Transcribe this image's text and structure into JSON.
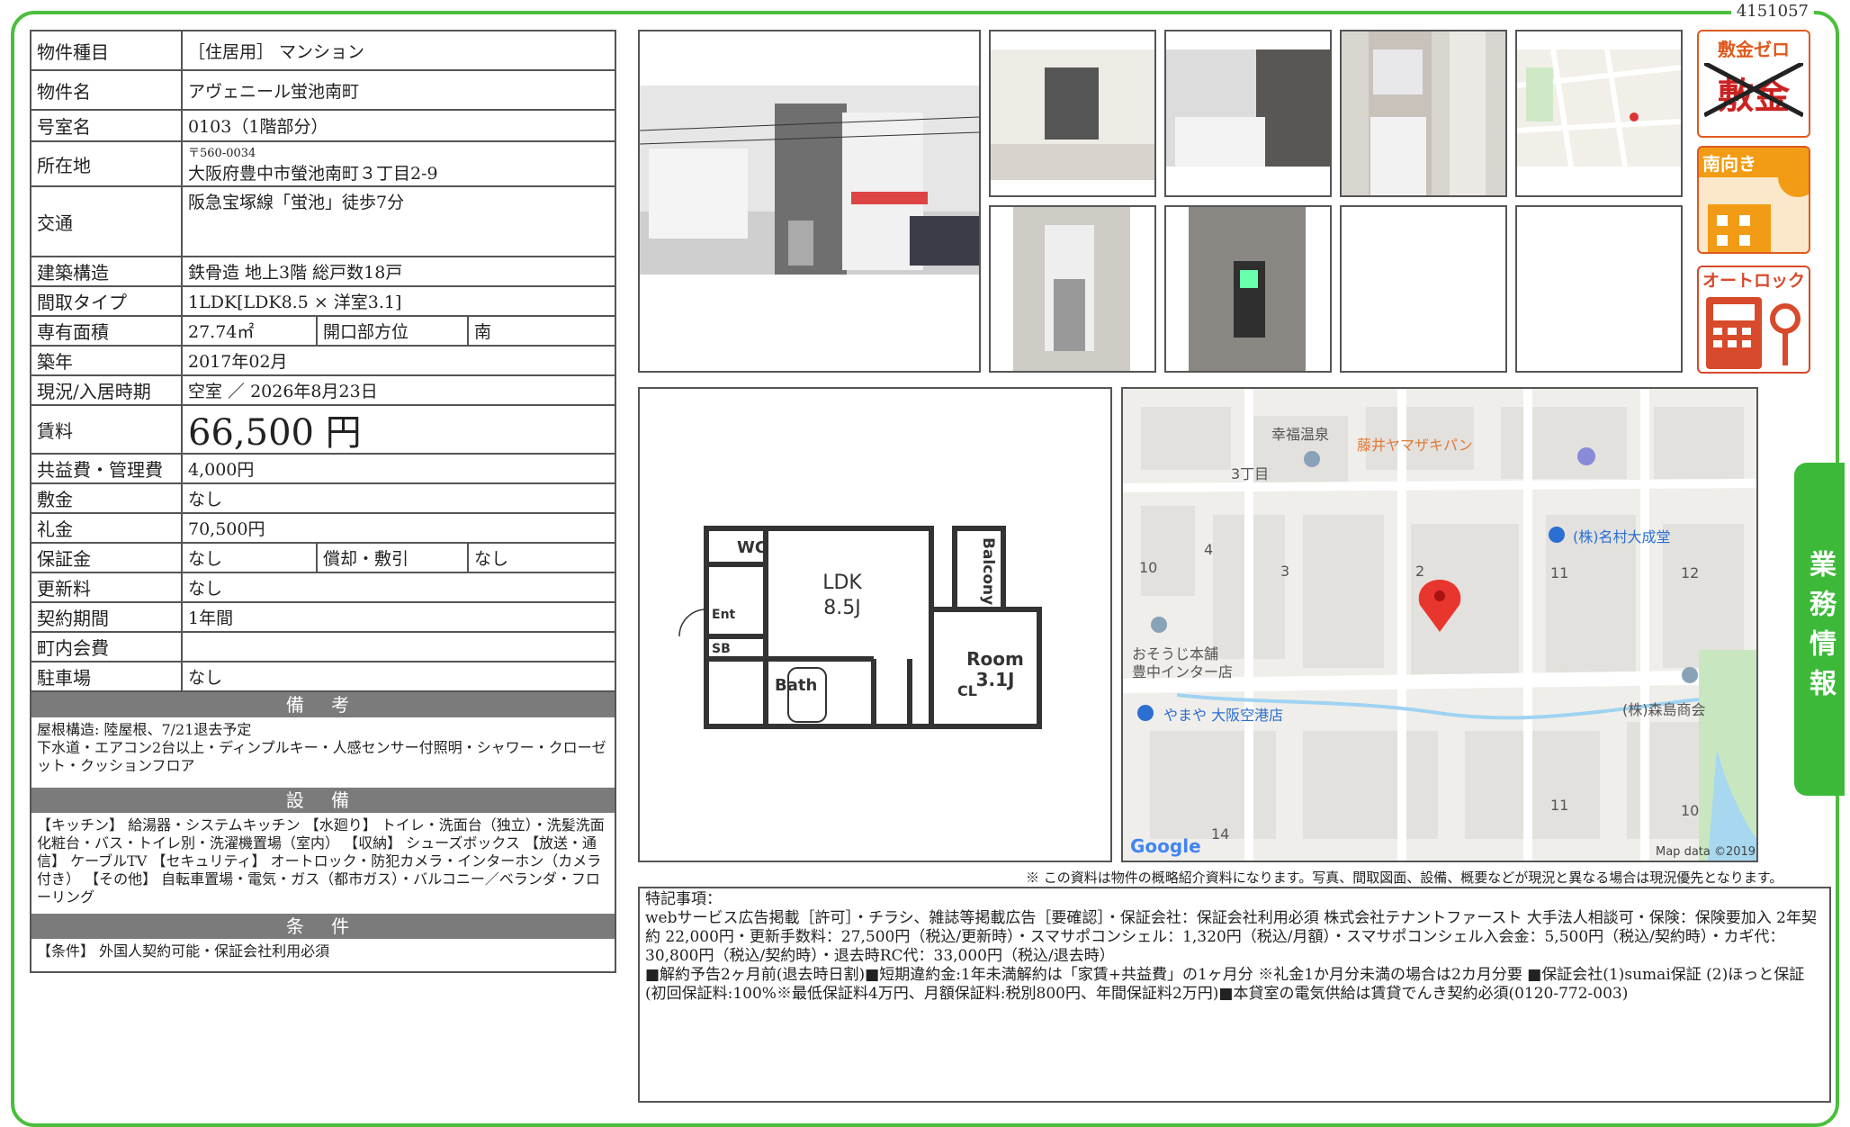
{
  "doc_id": "4151057",
  "property": {
    "type_label": "物件種目",
    "type_value": "［住居用］ マンション",
    "name_label": "物件名",
    "name_value": "アヴェニール蛍池南町",
    "room_label": "号室名",
    "room_value": "0103（1階部分）",
    "address_label": "所在地",
    "postal": "〒560-0034",
    "address_value": "大阪府豊中市螢池南町３丁目2-9",
    "transport_label": "交通",
    "transport_value": "阪急宝塚線「蛍池」徒歩7分",
    "structure_label": "建築構造",
    "structure_value": "鉄骨造 地上3階 総戸数18戸",
    "layout_label": "間取タイプ",
    "layout_value": "1LDK[LDK8.5 × 洋室3.1]",
    "area_label": "専有面積",
    "area_value": "27.74㎡",
    "facing_label": "開口部方位",
    "facing_value": "南",
    "built_label": "築年",
    "built_value": "2017年02月",
    "status_label": "現況/入居時期",
    "status_value": "空室 ／ 2026年8月23日",
    "rent_label": "賃料",
    "rent_value": "66,500 円",
    "fee_label": "共益費・管理費",
    "fee_value": "4,000円",
    "deposit_label": "敷金",
    "deposit_value": "なし",
    "key_label": "礼金",
    "key_value": "70,500円",
    "guarantee_label": "保証金",
    "guarantee_value": "なし",
    "amort_label": "償却・敷引",
    "amort_value": "なし",
    "renew_label": "更新料",
    "renew_value": "なし",
    "contract_label": "契約期間",
    "contract_value": "1年間",
    "town_label": "町内会費",
    "town_value": "",
    "parking_label": "駐車場",
    "parking_value": "なし"
  },
  "sections": {
    "remarks_head": "備 考",
    "remarks_text": "屋根構造: 陸屋根、7/21退去予定\n下水道・エアコン2台以上・ディンプルキー・人感センサー付照明・シャワー・クローゼット・クッションフロア",
    "equip_head": "設 備",
    "equip_text": "【キッチン】 給湯器・システムキッチン 【水廻り】 トイレ・洗面台（独立）・洗髪洗面化粧台・バス・トイレ別・洗濯機置場（室内） 【収納】 シューズボックス 【放送・通信】 ケーブルTV 【セキュリティ】 オートロック・防犯カメラ・インターホン（カメラ付き） 【その他】 自転車置場・電気・ガス（都市ガス）・バルコニー／ベランダ・フローリング",
    "cond_head": "条 件",
    "cond_text": "【条件】 外国人契約可能・保証会社利用必須"
  },
  "badges": {
    "zero_deposit": "敷金ゼロ",
    "zero_deposit_cross": "敷金",
    "south": "南向き",
    "autolock": "オートロック"
  },
  "floorplan": {
    "wc": "WC",
    "ent": "Ent",
    "sb": "SB",
    "bath": "Bath",
    "ldk": "LDK",
    "ldk_size": "8.5J",
    "balcony": "Balcony",
    "room": "Room",
    "room_size": "3.1J",
    "cl": "CL"
  },
  "map": {
    "labels": [
      "幸福温泉",
      "藤井ヤマザキパン",
      "3丁目",
      "(株)名村大成堂",
      "10",
      "4",
      "3",
      "2",
      "11",
      "12",
      "おそうじ本舗",
      "豊中インター店",
      "やまや 大阪空港店",
      "(株)森島商会",
      "11",
      "10",
      "14"
    ],
    "google": "Google",
    "mapdata": "Map data ©2019"
  },
  "side_tab": "業務情報",
  "footnote": "※ この資料は物件の概略紹介資料になります。写真、間取図面、設備、概要などが現況と異なる場合は現況優先となります。",
  "special": {
    "title": "特記事項：",
    "text": "webサービス広告掲載［許可］・チラシ、雑誌等掲載広告［要確認］・保証会社：保証会社利用必須 株式会社テナントファースト 大手法人相談可・保険：保険要加入 2年契約 22,000円・更新手数料：27,500円（税込/更新時）・スマサポコンシェル：1,320円（税込/月額）・スマサポコンシェル入会金：5,500円（税込/契約時）・カギ代：30,800円（税込/契約時）・退去時RC代：33,000円（税込/退去時）\n■解約予告2ヶ月前(退去時日割)■短期違約金:1年未満解約は「家賃+共益費」の1ヶ月分 ※礼金1か月分未満の場合は2カ月分要 ■保証会社(1)sumai保証 (2)ほっと保証(初回保証料:100%※最低保証料4万円、月額保証料:税別800円、年間保証料2万円)■本貸室の電気供給は賃貸でんき契約必須(0120-772-003)"
  },
  "colors": {
    "accent_green": "#3db93a",
    "badge_orange": "#e05a1e",
    "header_gray": "#7b7b7b"
  }
}
